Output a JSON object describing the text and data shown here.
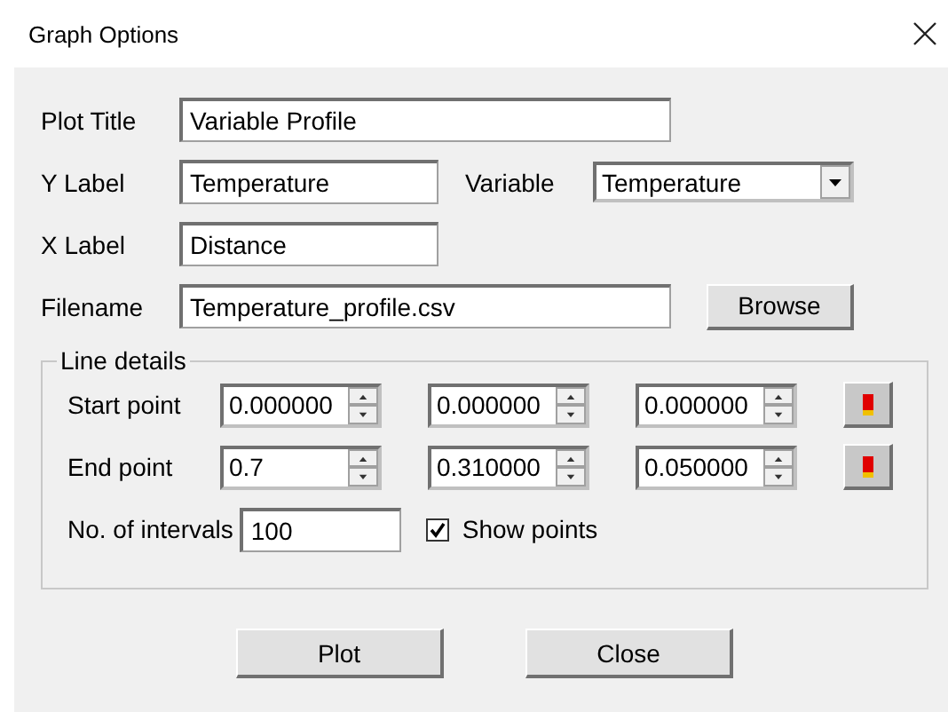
{
  "window": {
    "title": "Graph Options"
  },
  "plot_title": {
    "label": "Plot Title",
    "value": "Variable Profile"
  },
  "y_label": {
    "label": "Y Label",
    "value": "Temperature"
  },
  "variable": {
    "label": "Variable",
    "value": "Temperature"
  },
  "x_label": {
    "label": "X Label",
    "value": "Distance"
  },
  "filename": {
    "label": "Filename",
    "value": "Temperature_profile.csv",
    "button": "Browse"
  },
  "line_details": {
    "title": "Line details",
    "rows": [
      {
        "label": "Start point",
        "values": [
          "0.000000",
          "0.000000",
          "0.000000"
        ]
      },
      {
        "label": "End point",
        "values": [
          "0.7",
          "0.310000",
          "0.050000"
        ]
      }
    ],
    "intervals": {
      "label": "No. of intervals",
      "value": "100"
    },
    "show_points": {
      "label": "Show points",
      "checked": true
    }
  },
  "buttons": [
    "Plot",
    "Close"
  ]
}
